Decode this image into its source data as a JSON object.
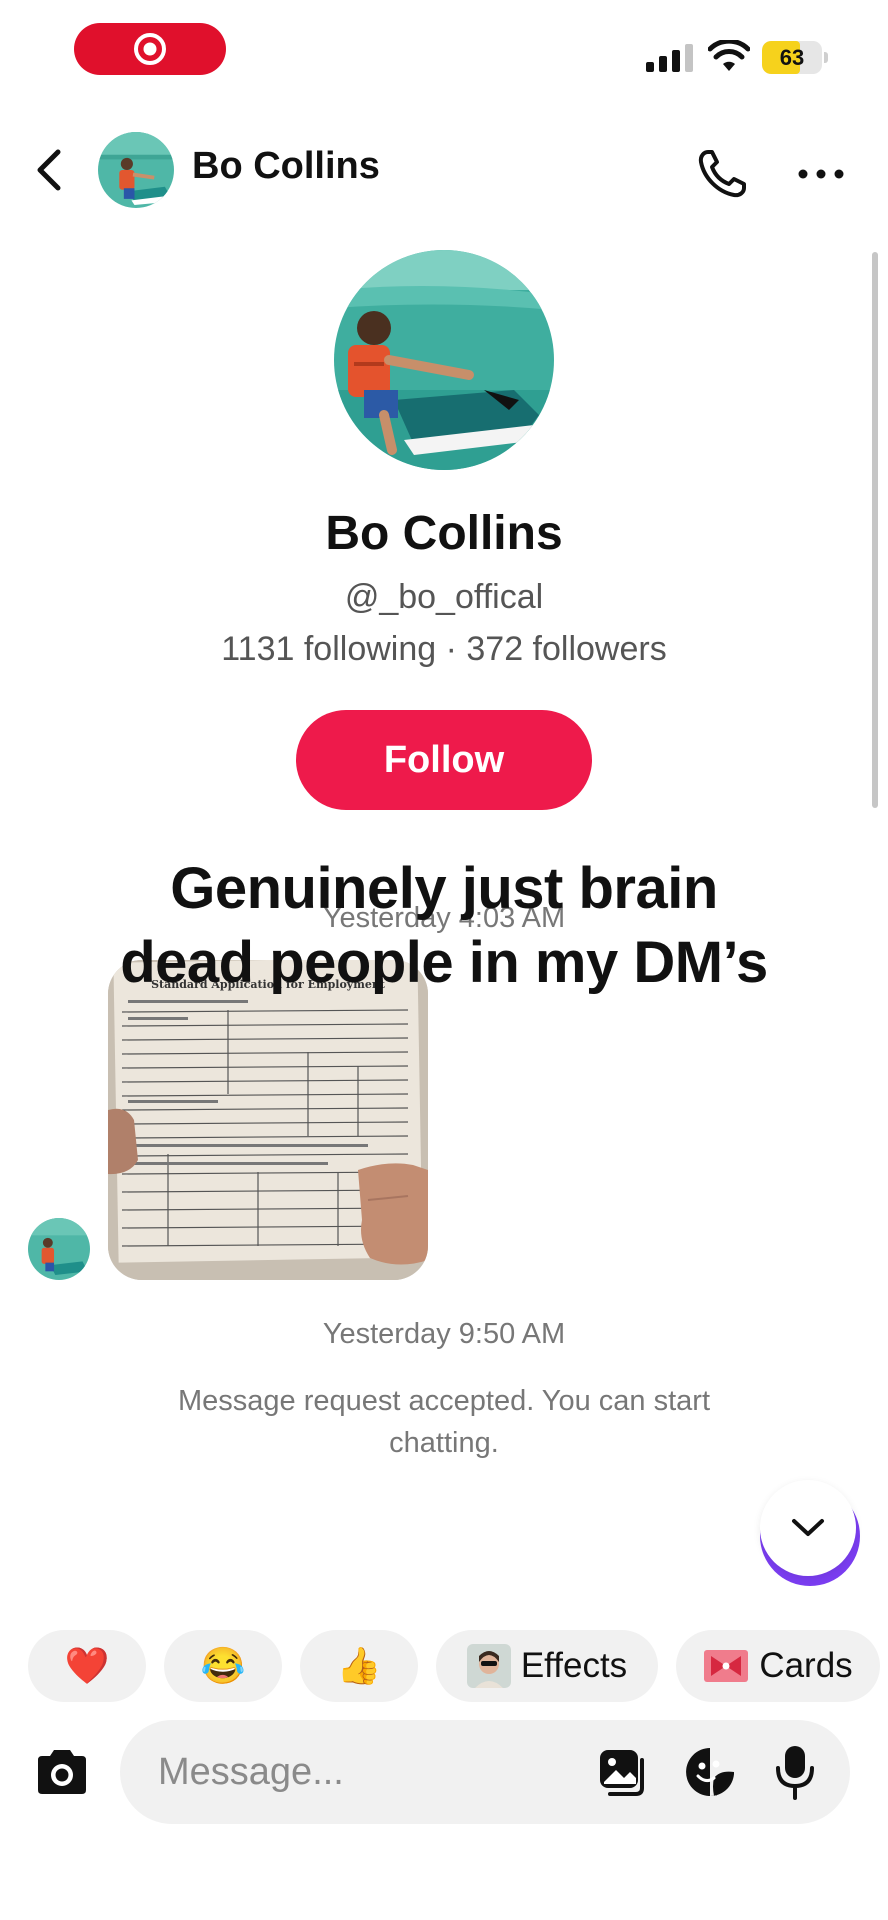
{
  "status_bar": {
    "battery_percent": "63",
    "battery_level": 0.63,
    "accent_record": "#e0102c",
    "icons": [
      "record-icon",
      "signal-icon",
      "wifi-icon",
      "battery-icon"
    ]
  },
  "header": {
    "name": "Bo Collins",
    "icons": [
      "back-icon",
      "phone-icon",
      "more-icon"
    ]
  },
  "profile": {
    "name": "Bo Collins",
    "handle": "@_bo_offical",
    "stats": "1131 following · 372 followers",
    "follow_label": "Follow",
    "follow_color": "#ee1a4b"
  },
  "chat": {
    "timestamp_1": "Yesterday 4:03 AM",
    "overlay_caption": "Genuinely just brain dead people in my DM’s",
    "photo_document_title": "Standard Application for Employment",
    "timestamp_2": "Yesterday 9:50 AM",
    "system_message": "Message request accepted. You can start chatting."
  },
  "quick_reactions": {
    "heart": "❤️",
    "laugh": "😂",
    "thumbs": "👍",
    "effects_label": "Effects",
    "cards_label": "Cards"
  },
  "composer": {
    "placeholder": "Message...",
    "icons": [
      "camera-icon",
      "gallery-icon",
      "sticker-icon",
      "mic-icon"
    ]
  }
}
